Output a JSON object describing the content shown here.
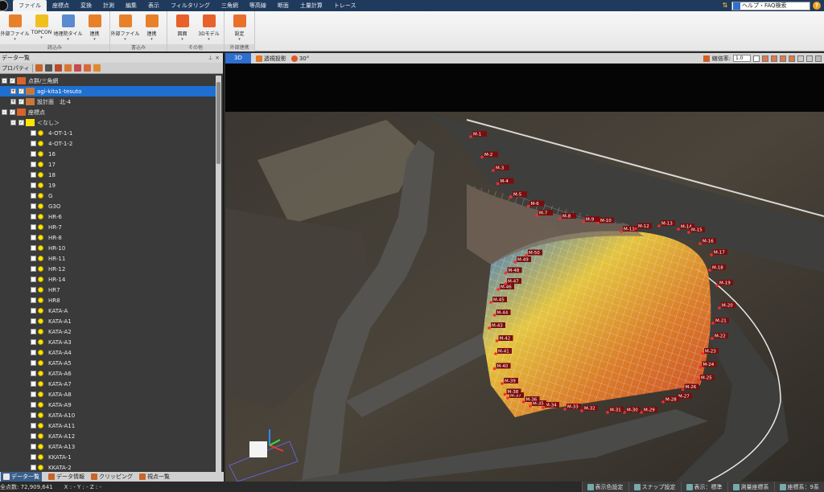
{
  "menu": [
    "ファイル",
    "座標点",
    "変換",
    "計測",
    "編集",
    "表示",
    "フィルタリング",
    "三角網",
    "等高線",
    "断面",
    "土量計算",
    "トレース"
  ],
  "help": {
    "label": "ヘルプ・FAQ検索",
    "bim_icon": "bim-icon"
  },
  "ribbon": {
    "groups": [
      {
        "name": "読込み",
        "buttons": [
          {
            "label": "外部ファイル",
            "icon": "file-import-icon",
            "color": "#e8802a"
          },
          {
            "label": "TOPCON",
            "icon": "topcon-icon",
            "color": "#f0c020"
          },
          {
            "label": "地理院タイル",
            "icon": "gsi-tile-icon",
            "color": "#5a8ad0"
          },
          {
            "label": "連携",
            "icon": "link-icon",
            "color": "#e8802a"
          }
        ]
      },
      {
        "name": "書込み",
        "buttons": [
          {
            "label": "外部ファイル",
            "icon": "file-export-icon",
            "color": "#e8802a"
          },
          {
            "label": "連携",
            "icon": "link-export-icon",
            "color": "#e8802a"
          }
        ]
      },
      {
        "name": "その他",
        "buttons": [
          {
            "label": "図面",
            "icon": "cad-icon",
            "color": "#e8602a"
          },
          {
            "label": "3Dモデル",
            "icon": "3d-model-icon",
            "color": "#e8602a"
          }
        ]
      },
      {
        "name": "外部連携",
        "buttons": [
          {
            "label": "設定",
            "icon": "gear-icon",
            "color": "#e8702a"
          }
        ]
      }
    ]
  },
  "left_panel": {
    "title": "データ一覧",
    "property_label": "プロパティ",
    "tree": [
      {
        "label": "点群/三角網",
        "level": 0,
        "expand": "-",
        "checked": true,
        "icon": "pointcloud-group-icon"
      },
      {
        "label": "agi-kita1-tesuto",
        "level": 1,
        "expand": "+",
        "checked": true,
        "icon": "pointcloud-icon",
        "selected": true
      },
      {
        "label": "設計面　北-4",
        "level": 1,
        "expand": "+",
        "checked": true,
        "icon": "design-surface-icon"
      },
      {
        "label": "座標点",
        "level": 0,
        "expand": "-",
        "checked": true,
        "icon": "coordinate-group-icon"
      },
      {
        "label": "＜なし＞",
        "level": 1,
        "expand": "-",
        "checked": true,
        "icon": "point-layer-icon"
      },
      {
        "label": "4-OT-1-1",
        "level": 2
      },
      {
        "label": "4-OT-1-2",
        "level": 2
      },
      {
        "label": "16",
        "level": 2
      },
      {
        "label": "17",
        "level": 2
      },
      {
        "label": "18",
        "level": 2
      },
      {
        "label": "19",
        "level": 2
      },
      {
        "label": "G",
        "level": 2
      },
      {
        "label": "G3O",
        "level": 2
      },
      {
        "label": "HR-6",
        "level": 2
      },
      {
        "label": "HR-7",
        "level": 2
      },
      {
        "label": "HR-8",
        "level": 2
      },
      {
        "label": "HR-10",
        "level": 2
      },
      {
        "label": "HR-11",
        "level": 2
      },
      {
        "label": "HR-12",
        "level": 2
      },
      {
        "label": "HR-14",
        "level": 2
      },
      {
        "label": "HR7",
        "level": 2
      },
      {
        "label": "HR8",
        "level": 2
      },
      {
        "label": "KATA-A",
        "level": 2
      },
      {
        "label": "KATA-A1",
        "level": 2
      },
      {
        "label": "KATA-A2",
        "level": 2
      },
      {
        "label": "KATA-A3",
        "level": 2
      },
      {
        "label": "KATA-A4",
        "level": 2
      },
      {
        "label": "KATA-A5",
        "level": 2
      },
      {
        "label": "KATA-A6",
        "level": 2
      },
      {
        "label": "KATA-A7",
        "level": 2
      },
      {
        "label": "KATA-A8",
        "level": 2
      },
      {
        "label": "KATA-A9",
        "level": 2
      },
      {
        "label": "KATA-A10",
        "level": 2
      },
      {
        "label": "KATA-A11",
        "level": 2
      },
      {
        "label": "KATA-A12",
        "level": 2
      },
      {
        "label": "KATA-A13",
        "level": 2
      },
      {
        "label": "KKATA-1",
        "level": 2
      },
      {
        "label": "KKATA-2",
        "level": 2
      }
    ],
    "tabs": [
      {
        "label": "データ一覧",
        "active": true,
        "icon": "data-list-icon"
      },
      {
        "label": "データ情報",
        "active": false,
        "icon": "data-info-icon"
      },
      {
        "label": "クリッピング",
        "active": false,
        "icon": "clipping-icon"
      },
      {
        "label": "視点一覧",
        "active": false,
        "icon": "viewpoint-icon"
      }
    ]
  },
  "viewport": {
    "tab": "3D",
    "perspective_label": "透視投影",
    "angle_label": "30°",
    "zoom_label": "縮倍率:",
    "zoom_value": "1.0",
    "markers": [
      "M-1",
      "M-2",
      "M-3",
      "M-4",
      "M-5",
      "M-6",
      "M-7",
      "M-8",
      "M-9",
      "M-10",
      "M-11",
      "M-12",
      "M-13",
      "M-14",
      "M-15",
      "M-16",
      "M-17",
      "M-18",
      "M-19",
      "M-20",
      "M-21",
      "M-22",
      "M-23",
      "M-24",
      "M-25",
      "M-26",
      "M-27",
      "M-28",
      "M-29",
      "M-30",
      "M-31",
      "M-32",
      "M-33",
      "M-34",
      "M-35",
      "M-36",
      "M-37",
      "M-38",
      "M-39",
      "M-40",
      "M-41",
      "M-42",
      "M-43",
      "M-44",
      "M-45",
      "M-46",
      "M-47",
      "M-48",
      "M-49",
      "M-50"
    ]
  },
  "status": {
    "points": "全点数: 72,909,641",
    "coords": "X : -  Y : -  Z : -",
    "buttons": [
      {
        "label": "表示色設定",
        "icon": "color-setting-icon"
      },
      {
        "label": "スナップ設定",
        "icon": "snap-setting-icon"
      },
      {
        "label": "表示：標準",
        "icon": "display-mode-icon"
      },
      {
        "label": "測量座標系",
        "icon": "survey-coord-icon"
      },
      {
        "label": "座標系：9系",
        "icon": "coord-system-icon"
      }
    ]
  }
}
